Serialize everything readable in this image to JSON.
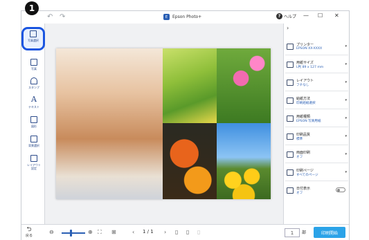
{
  "marker": {
    "number": "1"
  },
  "window": {
    "title": "Epson Photo+",
    "logo_glyph": "E",
    "help_label": "ヘルプ",
    "help_glyph": "?",
    "minimize_glyph": "—",
    "maximize_glyph": "☐",
    "close_glyph": "✕",
    "undo_glyph": "↶",
    "redo_glyph": "↷"
  },
  "leftbar": {
    "items": [
      {
        "label": "写真選択",
        "icon": "photo-select-icon"
      },
      {
        "label": "写真",
        "icon": "photo-icon"
      },
      {
        "label": "スタンプ",
        "icon": "stamp-icon"
      },
      {
        "label": "テキスト",
        "icon": "text-icon",
        "glyph": "A"
      },
      {
        "label": "図形",
        "icon": "shape-icon"
      },
      {
        "label": "背景選択",
        "icon": "background-icon"
      },
      {
        "label": "レイアウト\n設定",
        "icon": "layout-settings-icon"
      }
    ]
  },
  "bottombar": {
    "back_label": "戻る",
    "back_glyph": "⮌",
    "zoom_out_glyph": "⊖",
    "zoom_in_glyph": "⊕",
    "fit_glyph": "⛶",
    "grid_glyph": "⊞",
    "prev_glyph": "‹",
    "next_glyph": "›",
    "page_indicator": "1 / 1",
    "copies_value": "1",
    "copies_unit": "部",
    "print_button": "印刷開始"
  },
  "rightpanel": {
    "collapse_glyph": "›",
    "settings": [
      {
        "name": "プリンター",
        "value": "EPSON XX-XXXX",
        "icon": "printer-icon"
      },
      {
        "name": "用紙サイズ",
        "value": "L判 89 x 127 mm",
        "icon": "paper-size-icon"
      },
      {
        "name": "レイアウト",
        "value": "フチなし",
        "icon": "layout-icon"
      },
      {
        "name": "給紙方法",
        "value": "印刷給紙選択",
        "icon": "paper-feed-icon"
      },
      {
        "name": "用紙種類",
        "value": "EPSON 写真用紙",
        "icon": "paper-type-icon"
      },
      {
        "name": "印刷品質",
        "value": "標準",
        "icon": "quality-icon"
      },
      {
        "name": "両面印刷",
        "value": "オフ",
        "icon": "duplex-icon"
      },
      {
        "name": "印刷ページ",
        "value": "すべてのページ",
        "icon": "pages-icon"
      },
      {
        "name": "日付表示",
        "value": "オフ",
        "icon": "date-icon",
        "toggle": false
      }
    ]
  }
}
